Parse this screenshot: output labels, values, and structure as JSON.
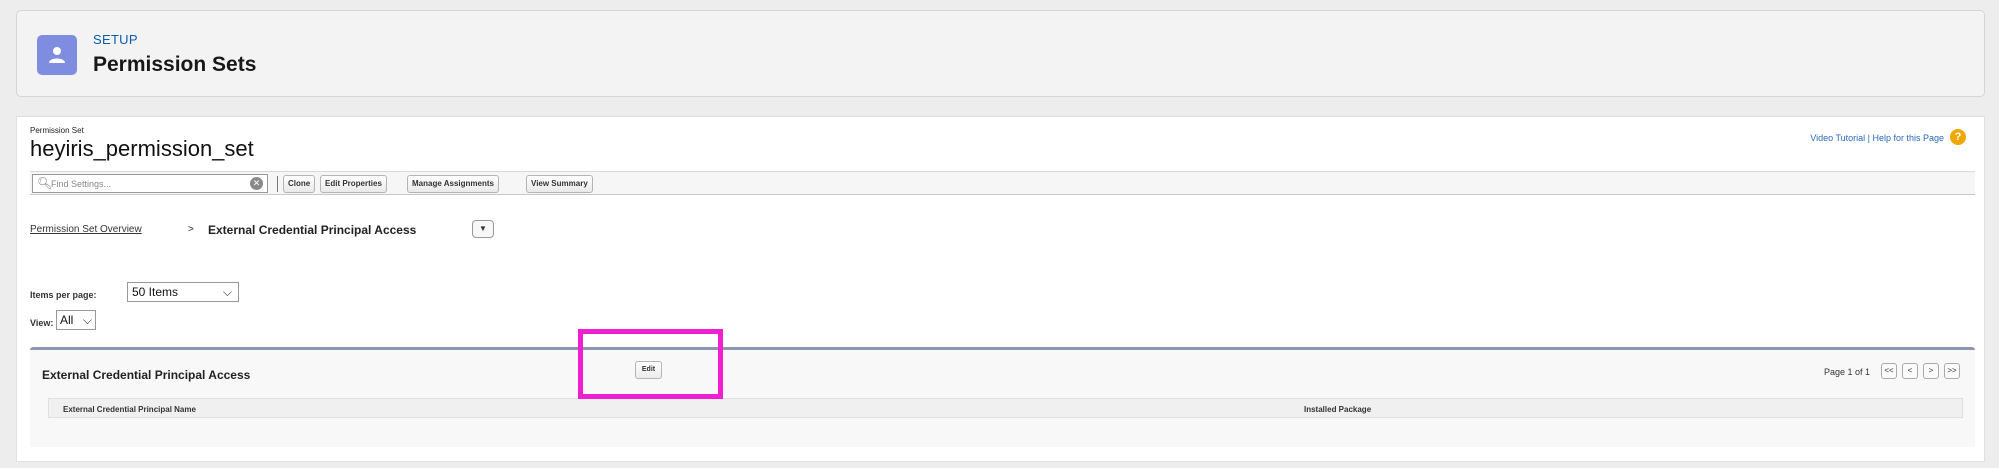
{
  "header": {
    "eyebrow": "SETUP",
    "title": "Permission Sets",
    "icon": "user-icon",
    "icon_color": "#7f8de1"
  },
  "permission_set": {
    "label": "Permission Set",
    "name": "heyiris_permission_set"
  },
  "help": {
    "link_text": "Video Tutorial | Help for this Page",
    "icon": "?"
  },
  "toolbar": {
    "search_placeholder": "Find Settings...",
    "clear_icon": "✕",
    "buttons": [
      "Clone",
      "Edit Properties",
      "Manage Assignments",
      "View Summary"
    ]
  },
  "breadcrumb": {
    "link": "Permission Set Overview",
    "separator": ">",
    "current": "External Credential Principal Access",
    "dropdown_glyph": "▼"
  },
  "filters": {
    "items_label": "Items per page:",
    "items_value": "50 Items",
    "view_label": "View:",
    "view_value": "All"
  },
  "related_list": {
    "title": "External Credential Principal Access",
    "edit_label": "Edit",
    "pager_text": "Page 1 of 1",
    "pager_buttons": [
      "<<",
      "<",
      ">",
      ">>"
    ],
    "columns": [
      "External Credential Principal Name",
      "Installed Package"
    ]
  },
  "annotation": {
    "highlight_color": "#f01fd0"
  }
}
